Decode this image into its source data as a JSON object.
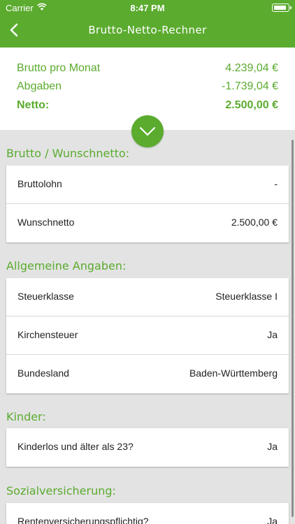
{
  "status_bar": {
    "carrier": "Carrier",
    "time": "8:47 PM"
  },
  "nav": {
    "title": "Brutto-Netto-Rechner",
    "back_icon": "chevron-left-icon"
  },
  "summary": {
    "rows": [
      {
        "label": "Brutto pro Monat",
        "value": "4.239,04 €"
      },
      {
        "label": "Abgaben",
        "value": "-1.739,04 €"
      },
      {
        "label": "Netto:",
        "value": "2.500,00 €"
      }
    ],
    "toggle_icon": "chevron-down-icon"
  },
  "sections": [
    {
      "header": "Brutto / Wunschnetto:",
      "rows": [
        {
          "label": "Bruttolohn",
          "value": "-"
        },
        {
          "label": "Wunschnetto",
          "value": "2.500,00 €"
        }
      ]
    },
    {
      "header": "Allgemeine Angaben:",
      "rows": [
        {
          "label": "Steuerklasse",
          "value": "Steuerklasse I"
        },
        {
          "label": "Kirchensteuer",
          "value": "Ja"
        },
        {
          "label": "Bundesland",
          "value": "Baden-Württemberg"
        }
      ]
    },
    {
      "header": "Kinder:",
      "rows": [
        {
          "label": "Kinderlos und älter als 23?",
          "value": "Ja"
        }
      ]
    },
    {
      "header": "Sozialversicherung:",
      "rows": [
        {
          "label": "Rentenversicherungspflichtig?",
          "value": "Ja"
        }
      ]
    }
  ],
  "colors": {
    "accent": "#5bab2f",
    "background": "#e3e3e3",
    "card": "#ffffff"
  }
}
